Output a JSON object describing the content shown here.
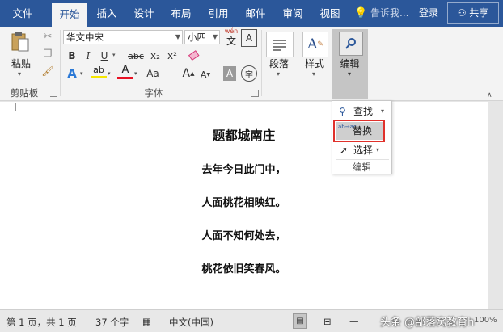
{
  "tabs": [
    "文件",
    "开始",
    "插入",
    "设计",
    "布局",
    "引用",
    "邮件",
    "审阅",
    "视图"
  ],
  "tell_me": "告诉我...",
  "login": "登录",
  "share": "共享",
  "clipboard": {
    "paste_label": "粘贴",
    "group_label": "剪贴板"
  },
  "font": {
    "family_value": "华文中宋",
    "size_value": "小四",
    "wen_label": "wén",
    "wen_char": "文",
    "group_label": "字体",
    "bold": "B",
    "italic": "I",
    "underline": "U",
    "strike": "abc",
    "sub": "x₂",
    "sup": "x²",
    "grow": "A",
    "shrink": "A",
    "aa": "Aa",
    "charshade": "A",
    "enclose": "字",
    "effect": "A",
    "color_a": "A",
    "clear": "A"
  },
  "paragraph": {
    "label": "段落"
  },
  "styles": {
    "label": "样式",
    "glyph": "A"
  },
  "editing": {
    "label": "编辑"
  },
  "dropdown": {
    "find": "查找",
    "replace": "替换",
    "replace_glyph": "ab→ac",
    "select": "选择",
    "group_label": "编辑"
  },
  "poem": {
    "title": "题都城南庄",
    "lines": [
      "去年今日此门中，",
      "人面桃花相映红。",
      "人面不知何处去，",
      "桃花依旧笑春风。"
    ]
  },
  "status": {
    "page": "第 1 页，共 1 页",
    "words": "37 个字",
    "language": "中文(中国)",
    "watermark": "头条 @部落窝教育h",
    "zoom": "100%"
  },
  "colors": {
    "accent": "#2b579a",
    "highlight": "#f5e600",
    "font_color": "#e81123",
    "red_box": "#e0312b"
  }
}
